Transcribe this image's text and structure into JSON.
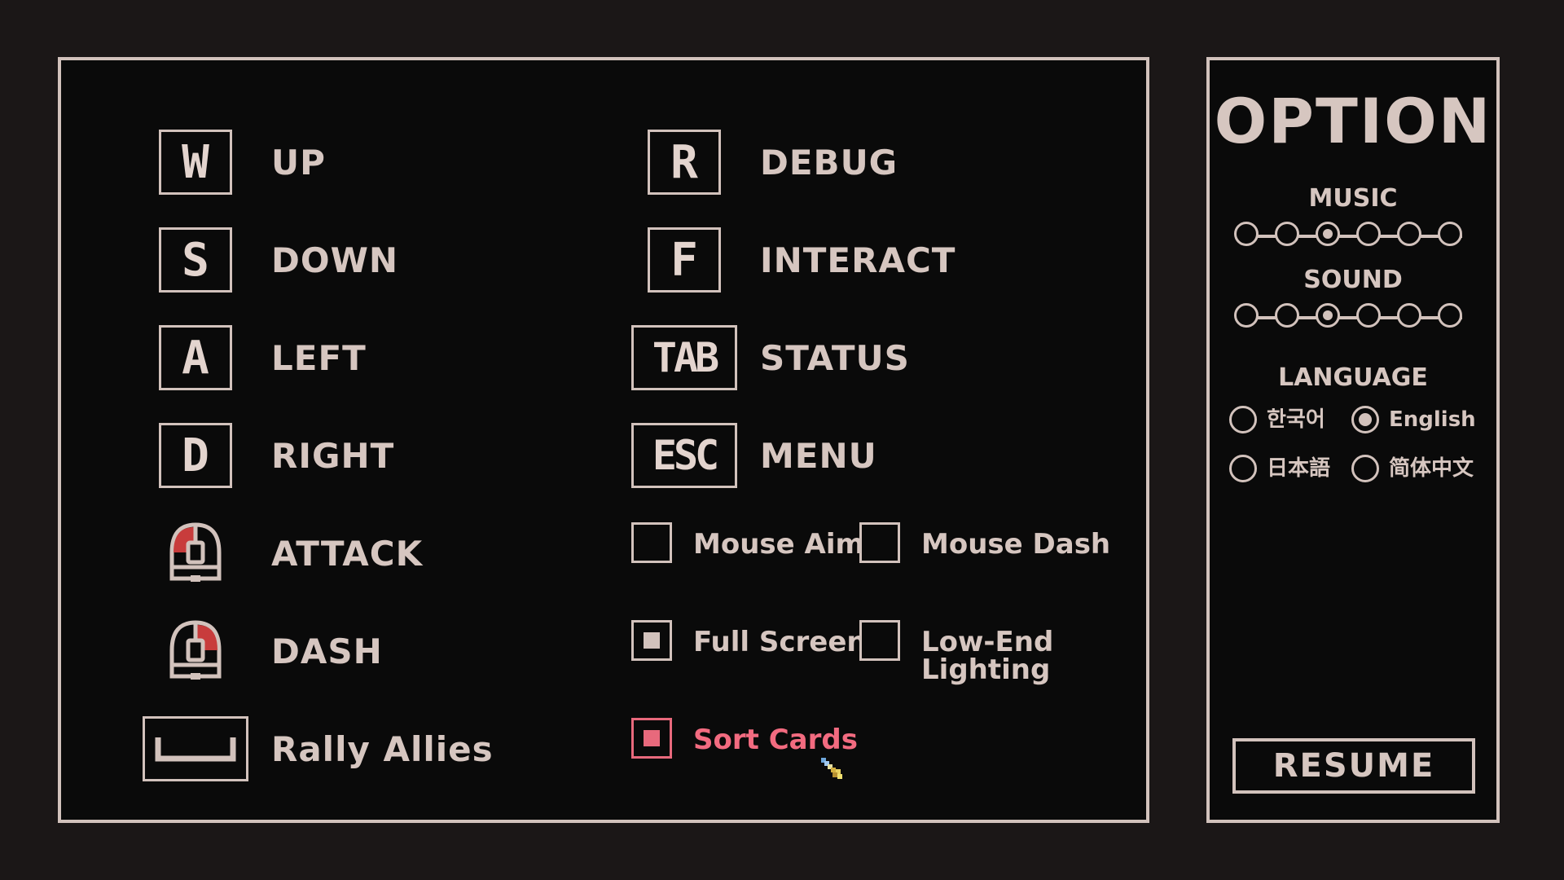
{
  "keybinds": [
    {
      "key": "W",
      "action": "UP"
    },
    {
      "key": "S",
      "action": "DOWN"
    },
    {
      "key": "A",
      "action": "LEFT"
    },
    {
      "key": "D",
      "action": "RIGHT"
    },
    {
      "key": "mouse-left",
      "action": "ATTACK"
    },
    {
      "key": "mouse-right",
      "action": "DASH"
    },
    {
      "key": "space",
      "action": "Rally Allies"
    }
  ],
  "keybinds_right": [
    {
      "key": "R",
      "action": "DEBUG"
    },
    {
      "key": "F",
      "action": "INTERACT"
    },
    {
      "key": "TAB",
      "action": "STATUS"
    },
    {
      "key": "ESC",
      "action": "MENU"
    }
  ],
  "toggles": {
    "mouse_aim": {
      "label": "Mouse Aim",
      "checked": false
    },
    "mouse_dash": {
      "label": "Mouse Dash",
      "checked": false
    },
    "full_screen": {
      "label": "Full Screen",
      "checked": true
    },
    "low_end_lighting": {
      "label": "Low-End Lighting",
      "checked": false
    },
    "sort_cards": {
      "label": "Sort Cards",
      "checked": true,
      "highlighted": true
    }
  },
  "options": {
    "title": "OPTION",
    "music": {
      "label": "MUSIC",
      "level": 3,
      "steps": 6
    },
    "sound": {
      "label": "SOUND",
      "level": 3,
      "steps": 6
    },
    "language": {
      "label": "LANGUAGE",
      "choices": [
        "한국어",
        "English",
        "日本語",
        "简体中文"
      ],
      "selected": "English"
    },
    "resume_label": "RESUME"
  },
  "colors": {
    "frame": "#d2c2bc",
    "text": "#d6c6c0",
    "highlight": "#f26b80",
    "mouse_accent": "#c83c3c",
    "background": "#1b1717",
    "panel": "#0a0a0a"
  },
  "icons": {
    "mouse_left": "mouse-left-click-icon",
    "mouse_right": "mouse-right-click-icon",
    "space": "spacebar-icon",
    "cursor": "pixel-cursor-icon"
  }
}
